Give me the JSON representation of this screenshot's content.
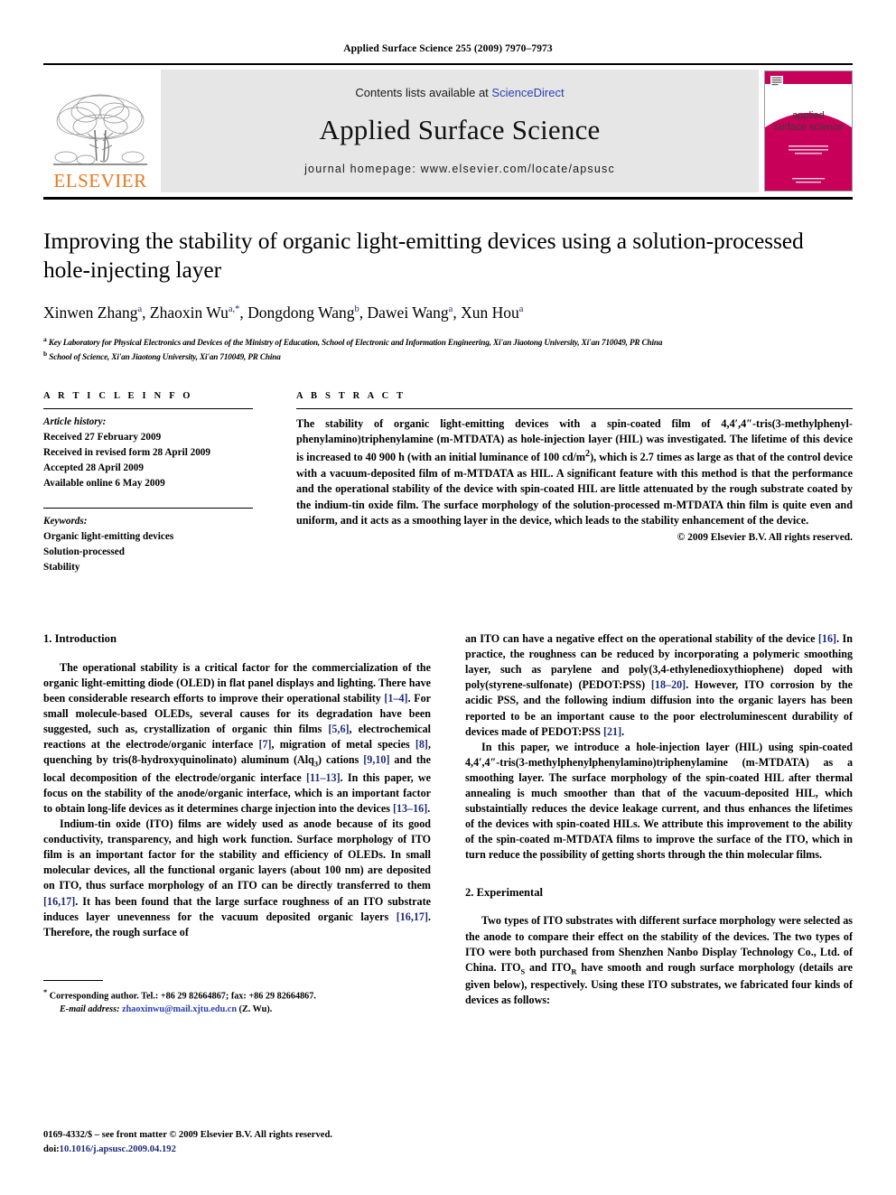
{
  "running_head": "Applied Surface Science 255 (2009) 7970–7973",
  "masthead": {
    "publisher_name": "ELSEVIER",
    "contents_prefix": "Contents lists available at ",
    "contents_link": "ScienceDirect",
    "journal_title": "Applied Surface Science",
    "homepage": "journal homepage: www.elsevier.com/locate/apsusc",
    "cover": {
      "line1": "applied",
      "line2": "surface science",
      "accent_color": "#C8005A",
      "band_color": "#e6e6e6"
    }
  },
  "article": {
    "title": "Improving the stability of organic light-emitting devices using a solution-processed hole-injecting layer",
    "authors": [
      {
        "name": "Xinwen Zhang",
        "marks": "a"
      },
      {
        "name": "Zhaoxin Wu",
        "marks": "a,*"
      },
      {
        "name": "Dongdong Wang",
        "marks": "b"
      },
      {
        "name": "Dawei Wang",
        "marks": "a"
      },
      {
        "name": "Xun Hou",
        "marks": "a"
      }
    ],
    "affiliations": [
      {
        "mark": "a",
        "text": "Key Laboratory for Physical Electronics and Devices of the Ministry of Education, School of Electronic and Information Engineering, Xi'an Jiaotong University, Xi'an 710049, PR China"
      },
      {
        "mark": "b",
        "text": "School of Science, Xi'an Jiaotong University, Xi'an 710049, PR China"
      }
    ]
  },
  "info": {
    "heading": "A R T I C L E  I N F O",
    "history_label": "Article history:",
    "history": [
      "Received 27 February 2009",
      "Received in revised form 28 April 2009",
      "Accepted 28 April 2009",
      "Available online 6 May 2009"
    ],
    "keywords_label": "Keywords:",
    "keywords": [
      "Organic light-emitting devices",
      "Solution-processed",
      "Stability"
    ]
  },
  "abstract": {
    "heading": "A B S T R A C T",
    "text_before_sup": "The stability of organic light-emitting devices with a spin-coated film of 4,4′,4″-tris(3-methylphenyl-phenylamino)triphenylamine (m-MTDATA) as hole-injection layer (HIL) was investigated. The lifetime of this device is increased to 40 900 h (with an initial luminance of 100 cd/m",
    "sup": "2",
    "text_after_sup": "), which is 2.7 times as large as that of the control device with a vacuum-deposited film of m-MTDATA as HIL. A significant feature with this method is that the performance and the operational stability of the device with spin-coated HIL are little attenuated by the rough substrate coated by the indium-tin oxide film. The surface morphology of the solution-processed m-MTDATA thin film is quite even and uniform, and it acts as a smoothing layer in the device, which leads to the stability enhancement of the device.",
    "copyright": "© 2009 Elsevier B.V. All rights reserved."
  },
  "sections": {
    "introduction_heading": "1.  Introduction",
    "experimental_heading": "2.  Experimental",
    "intro_p1_a": "The operational stability is a critical factor for the commercialization of the organic light-emitting diode (OLED) in flat panel displays and lighting. There have been considerable research efforts to improve their operational stability ",
    "intro_p1_r1": "[1–4]",
    "intro_p1_b": ". For small molecule-based OLEDs, several causes for its degradation have been suggested, such as, crystallization of organic thin films ",
    "intro_p1_r2": "[5,6]",
    "intro_p1_c": ", electrochemical reactions at the electrode/organic interface ",
    "intro_p1_r3": "[7]",
    "intro_p1_d": ", migration of metal species ",
    "intro_p1_r4": "[8]",
    "intro_p1_e": ", quenching by tris(8-hydroxyquinolinato) aluminum (Alq",
    "intro_p1_sub": "3",
    "intro_p1_f": ") cations ",
    "intro_p1_r5": "[9,10]",
    "intro_p1_g": " and the local decomposition of the electrode/organic interface ",
    "intro_p1_r6": "[11–13]",
    "intro_p1_h": ". In this paper, we focus on the stability of the anode/organic interface, which is an important factor to obtain long-life devices as it determines charge injection into the devices ",
    "intro_p1_r7": "[13–16]",
    "intro_p1_i": ".",
    "intro_p2_a": "Indium-tin oxide (ITO) films are widely used as anode because of its good conductivity, transparency, and high work function. Surface morphology of ITO film is an important factor for the stability and efficiency of OLEDs. In small molecular devices, all the functional organic layers (about 100 nm) are deposited on ITO, thus surface morphology of an ITO can be directly transferred to them ",
    "intro_p2_r1": "[16,17]",
    "intro_p2_b": ". It has been found that the large surface roughness of an ITO substrate induces layer unevenness for the vacuum deposited organic layers ",
    "intro_p2_r2": "[16,17]",
    "intro_p2_c": ". Therefore, the rough surface of",
    "intro_p3_a": "an ITO can have a negative effect on the operational stability of the device ",
    "intro_p3_r1": "[16]",
    "intro_p3_b": ". In practice, the roughness can be reduced by incorporating a polymeric smoothing layer, such as parylene and poly(3,4-ethylenedioxythiophene) doped with poly(styrene-sulfonate) (PEDOT:PSS) ",
    "intro_p3_r2": "[18–20]",
    "intro_p3_c": ". However, ITO corrosion by the acidic PSS, and the following indium diffusion into the organic layers has been reported to be an important cause to the poor electroluminescent durability of devices made of PEDOT:PSS ",
    "intro_p3_r3": "[21]",
    "intro_p3_d": ".",
    "intro_p4": "In this paper, we introduce a hole-injection layer (HIL) using spin-coated 4,4′,4″-tris(3-methylphenylphenylamino)triphenylamine (m-MTDATA) as a smoothing layer. The surface morphology of the spin-coated HIL after thermal annealing is much smoother than that of the vacuum-deposited HIL, which substaintially reduces the device leakage current, and thus enhances the lifetimes of the devices with spin-coated HILs. We attribute this improvement to the ability of the spin-coated m-MTDATA films to improve the surface of the ITO, which in turn reduce the possibility of getting shorts through the thin molecular films.",
    "exp_p1_a": "Two types of ITO substrates with different surface morphology were selected as the anode to compare their effect on the stability of the devices. The two types of ITO were both purchased from Shenzhen Nanbo Display Technology Co., Ltd. of China. ITO",
    "exp_p1_sub1": "S",
    "exp_p1_b": " and ITO",
    "exp_p1_sub2": "R",
    "exp_p1_c": " have smooth and rough surface morphology (details are given below), respectively. Using these ITO substrates, we fabricated four kinds of devices as follows:"
  },
  "footnote": {
    "marker": "*",
    "line1": "Corresponding author. Tel.: +86 29 82664867; fax: +86 29 82664867.",
    "email_label": "E-mail address:",
    "email": "zhaoxinwu@mail.xjtu.edu.cn",
    "email_suffix": "(Z. Wu)."
  },
  "page_footer": {
    "line1": "0169-4332/$ – see front matter © 2009 Elsevier B.V. All rights reserved.",
    "doi_prefix": "doi:",
    "doi": "10.1016/j.apsusc.2009.04.192"
  }
}
